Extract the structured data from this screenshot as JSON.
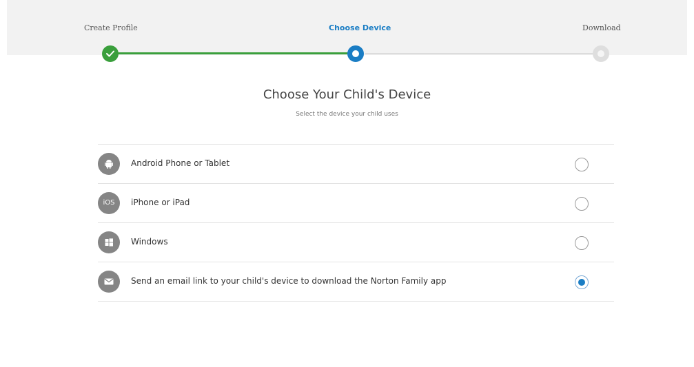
{
  "stepper": {
    "steps": [
      {
        "label": "Create Profile",
        "state": "done"
      },
      {
        "label": "Choose Device",
        "state": "current"
      },
      {
        "label": "Download",
        "state": "pending"
      }
    ]
  },
  "main": {
    "title": "Choose Your Child's Device",
    "subtitle": "Select the device your child uses"
  },
  "devices": [
    {
      "icon": "android-icon",
      "label": "Android Phone or Tablet",
      "selected": false
    },
    {
      "icon": "ios-icon",
      "icon_text": "iOS",
      "label": "iPhone or iPad",
      "selected": false
    },
    {
      "icon": "windows-icon",
      "label": "Windows",
      "selected": false
    },
    {
      "icon": "email-icon",
      "label": "Send an email link to your child's device to download the Norton Family app",
      "selected": true
    }
  ],
  "colors": {
    "accent": "#1a7dc4",
    "done": "#3a9f3c",
    "pending": "#dedede",
    "icon_bg": "#858585"
  }
}
